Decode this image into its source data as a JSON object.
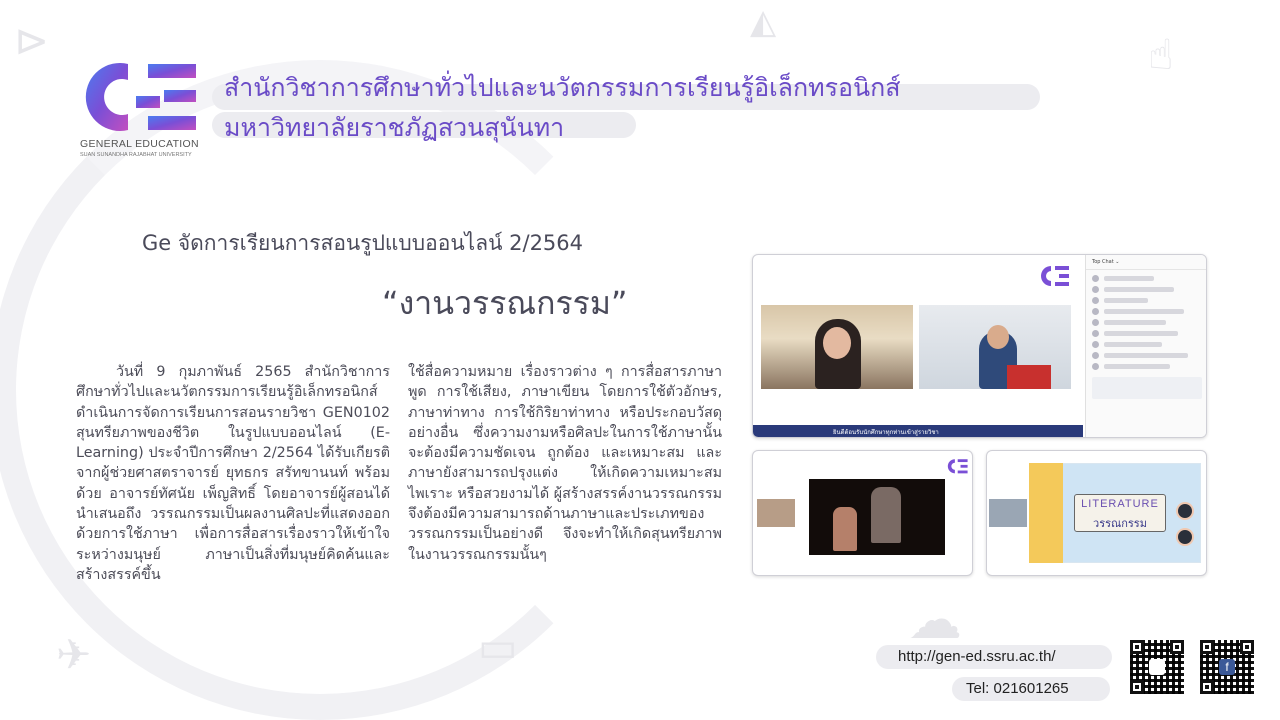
{
  "org": {
    "logo_text": "GENERAL EDUCATION",
    "logo_subtext": "SUAN SUNANDHA RAJABHAT UNIVERSITY",
    "title_line1": "สำนักวิชาการศึกษาทั่วไปและนวัตกรรมการเรียนรู้อิเล็กทรอนิกส์",
    "title_line2": "มหาวิทยาลัยราชภัฏสวนสุนันทา",
    "brand_colors": [
      "#6a4bc7",
      "#a14fc9",
      "#4b7cf0"
    ]
  },
  "article": {
    "subtitle": "Ge จัดการเรียนการสอนรูปแบบออนไลน์ 2/2564",
    "event_name": "“งานวรรณกรรม”",
    "col1": "วันที่ 9 กุมภาพันธ์ 2565 สำนักวิชาการศึกษาทั่วไปและนวัตกรรมการเรียนรู้อิเล็กทรอนิกส์ ดำเนินการจัดการเรียนการสอนรายวิชา GEN0102 สุนทรียภาพของชีวิต ในรูปแบบออนไลน์ (E-Learning) ประจำปีการศึกษา 2/2564 ได้รับเกียรติจากผู้ช่วยศาสตราจารย์ ยุทธกร สรัทขานนท์ พร้อมด้วย อาจารย์ทัศนัย เพ็ญสิทธิ์ โดยอาจารย์ผู้สอนได้นำเสนอถึง วรรณกรรมเป็นผลงานศิลปะที่แสดงออกด้วยการใช้ภาษา เพื่อการสื่อสารเรื่องราวให้เข้าใจระหว่างมนุษย์ ภาษาเป็นสิ่งที่มนุษย์คิดค้นและสร้างสรรค์ขึ้น",
    "col2": "ใช้สื่อความหมาย เรื่องราวต่าง ๆ การสื่อสารภาษาพูด การใช้เสียง, ภาษาเขียน โดยการใช้ตัวอักษร, ภาษาท่าทาง การใช้กิริยาท่าทาง หรือประกอบวัสดุอย่างอื่น ซึ่งความงามหรือศิลปะในการใช้ภาษานั้นจะต้องมีความชัดเจน ถูกต้อง และเหมาะสม และภาษายังสามารถปรุงแต่ง ให้เกิดความเหมาะสม ไพเราะ หรือสวยงามได้ ผู้สร้างสรรค์งานวรรณกรรมจึงต้องมีความสามารถด้านภาษาและประเภทของวรรณกรรมเป็นอย่างดี จึงจะทำให้เกิดสุนทรียภาพในงานวรรณกรรมนั้นๆ"
  },
  "images": {
    "main_chat_header": "Top Chat ⌄",
    "poster_title": "LITERATURE",
    "poster_subtitle": "วรรณกรรม"
  },
  "footer": {
    "url": "http://gen-ed.ssru.ac.th/",
    "tel": "Tel: 021601265"
  }
}
